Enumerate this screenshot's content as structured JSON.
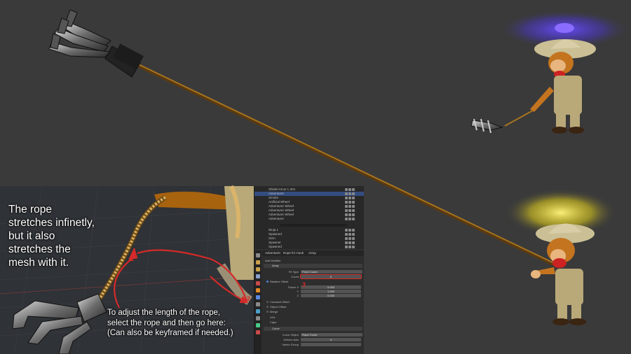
{
  "captions": {
    "main_lines": [
      "The rope",
      "stretches infinetly,",
      "but it also",
      "stretches the",
      "mesh with it."
    ],
    "instruction_lines": [
      "To adjust the length of the rope,",
      "select the rope and then go here:",
      "(Can also be keyframed if needed.)"
    ],
    "markers": [
      "1",
      "2",
      "3"
    ]
  },
  "blender": {
    "outliner_rows": [
      "Shield Armor L.001",
      "Adventurer",
      "Smoke",
      "Artificial Wheel",
      "Adventurer Wheel",
      "Adventurer Wheel",
      "Adventurer Wheel",
      "Adventurer",
      "Ninja 1",
      "Spawned",
      "Gem",
      "Spawner",
      "Spawned"
    ],
    "breadcrumb": [
      "Adventurer",
      "Rope for Hook",
      "Array"
    ],
    "add_modifier": "Add Modifier",
    "modifier_name": "Array",
    "fit_type_label": "Fit Type",
    "fit_type_value": "Fixed Count",
    "count_label": "Count",
    "count_value": "5",
    "relative_offset_label": "Relative Offset",
    "factor_label": "Factor X",
    "factor_values": [
      "0.000",
      "1.000",
      "0.000"
    ],
    "axis_labels": [
      "Y",
      "Z"
    ],
    "constant_offset_label": "Constant Offset",
    "object_offset_label": "Object Offset",
    "merge_label": "Merge",
    "uvs_label": "UVs",
    "caps_label": "Caps",
    "curve_modifier_name": "Curve",
    "curve_object_label": "Curve Object",
    "curve_object_value": "Rope Curve",
    "deform_axis_label": "Deform Axis",
    "deform_axis_value": "X",
    "vertex_group_label": "Vertex Group"
  },
  "colors": {
    "background": "#3a3a3a",
    "rope": "#8a5a1a",
    "arrow": "#d42a2a",
    "propeller_top": "#5a3cff",
    "propeller_bottom": "#f5e11a"
  }
}
